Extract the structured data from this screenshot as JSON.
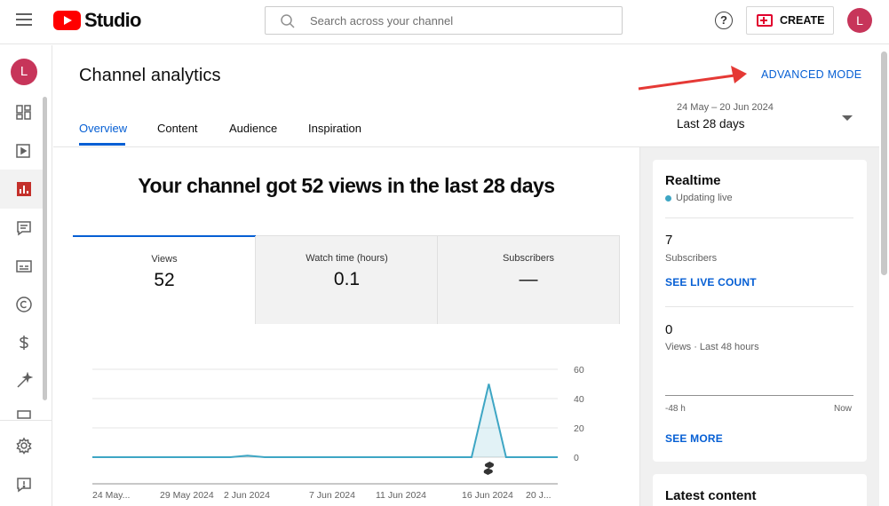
{
  "header": {
    "logo_text": "Studio",
    "search_placeholder": "Search across your channel",
    "help_label": "?",
    "create_label": "CREATE",
    "avatar_letter": "L"
  },
  "sidebar": {
    "avatar_letter": "L",
    "icons": [
      "dashboard-icon",
      "content-icon",
      "analytics-icon",
      "comments-icon",
      "subtitles-icon",
      "copyright-icon",
      "earn-icon",
      "customization-icon",
      "audio-library-icon",
      "settings-icon",
      "feedback-icon"
    ],
    "active": "analytics-icon"
  },
  "page": {
    "title": "Channel analytics",
    "advanced_mode": "ADVANCED MODE",
    "tabs": [
      {
        "label": "Overview",
        "active": true
      },
      {
        "label": "Content",
        "active": false
      },
      {
        "label": "Audience",
        "active": false
      },
      {
        "label": "Inspiration",
        "active": false
      }
    ],
    "date_range": "24 May – 20 Jun 2024",
    "date_label": "Last 28 days",
    "headline": "Your channel got 52 views in the last 28 days"
  },
  "metrics": [
    {
      "label": "Views",
      "value": "52",
      "active": true
    },
    {
      "label": "Watch time (hours)",
      "value": "0.1",
      "active": false
    },
    {
      "label": "Subscribers",
      "value": "—",
      "active": false
    }
  ],
  "chart_data": {
    "type": "area",
    "x": [
      "24 May...",
      "29 May 2024",
      "2 Jun 2024",
      "7 Jun 2024",
      "11 Jun 2024",
      "16 Jun 2024",
      "20 J..."
    ],
    "y_ticks": [
      60,
      40,
      20,
      0
    ],
    "ylim": [
      0,
      60
    ],
    "series": [
      {
        "values": [
          0,
          0,
          0,
          0,
          0,
          0,
          0,
          0,
          0,
          1,
          0,
          0,
          0,
          0,
          0,
          0,
          0,
          0,
          0,
          0,
          0,
          0,
          0,
          50,
          0,
          0,
          0,
          0
        ]
      }
    ],
    "color": "#3ea6c4"
  },
  "realtime": {
    "title": "Realtime",
    "status": "Updating live",
    "subscribers_value": "7",
    "subscribers_label": "Subscribers",
    "live_count_link": "SEE LIVE COUNT",
    "views_value": "0",
    "views_label": "Views · Last 48 hours",
    "axis_left": "-48 h",
    "axis_right": "Now",
    "see_more": "SEE MORE"
  },
  "latest_content": {
    "title": "Latest content"
  },
  "colors": {
    "accent": "#065fd4",
    "brand": "#ff0000",
    "chart_line": "#3ea6c4",
    "annotation_arrow": "#e53935"
  }
}
